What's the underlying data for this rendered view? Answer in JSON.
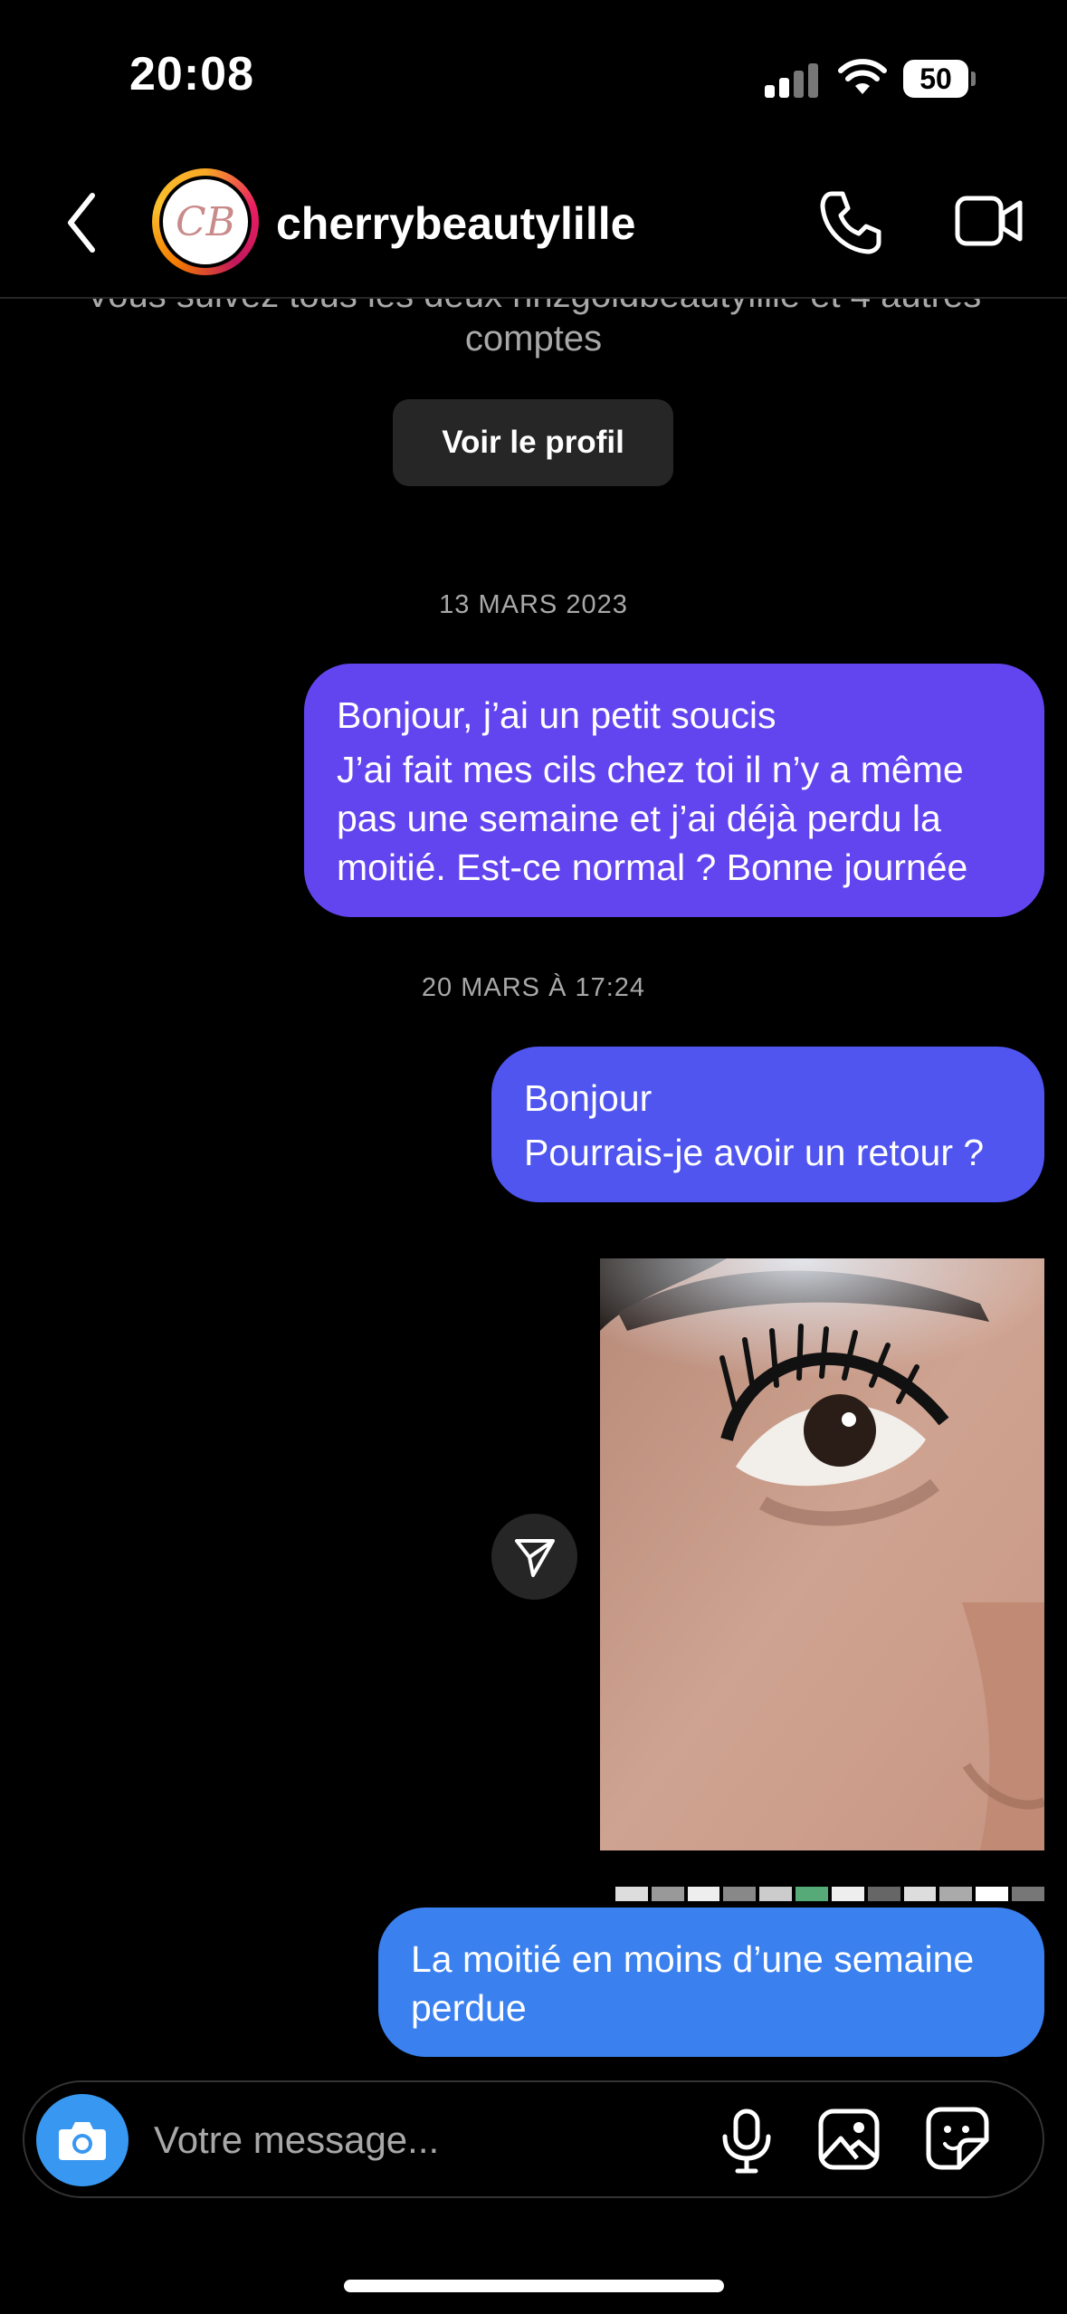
{
  "status_bar": {
    "time": "20:08",
    "battery": "50"
  },
  "header": {
    "username": "cherrybeautylille",
    "avatar_initials": "CB"
  },
  "profile_intro": {
    "followers_text": "Vous suivez tous les deux nnzgoldbeautylille et 4 autres",
    "followers_text_2": "comptes",
    "view_profile_label": "Voir le profil"
  },
  "messages": {
    "date_1": "13 MARS 2023",
    "m1": {
      "line1": "Bonjour, j’ai un petit soucis",
      "line2": "J’ai fait mes cils chez toi il n’y a même",
      "line3": "pas une semaine et j’ai déjà perdu la",
      "line4": "moitié. Est-ce normal ? Bonne journée"
    },
    "date_2": "20 MARS À 17:24",
    "m2": {
      "line1": "Bonjour",
      "line2": "Pourrais-je avoir un retour ?"
    },
    "m3": {
      "line1": "La moitié en moins d’une semaine",
      "line2": "perdue"
    }
  },
  "composer": {
    "placeholder": "Votre message..."
  },
  "icons": {
    "back": "chevron-left-icon",
    "call": "phone-icon",
    "video": "video-camera-icon",
    "share": "send-icon",
    "camera": "camera-icon",
    "mic": "microphone-icon",
    "gallery": "image-icon",
    "sticker": "sticker-icon"
  },
  "colors": {
    "bubble_1": "#6345f0",
    "bubble_2": "#4f55ee",
    "bubble_3": "#3a80ef",
    "camera_button": "#3897f0"
  }
}
